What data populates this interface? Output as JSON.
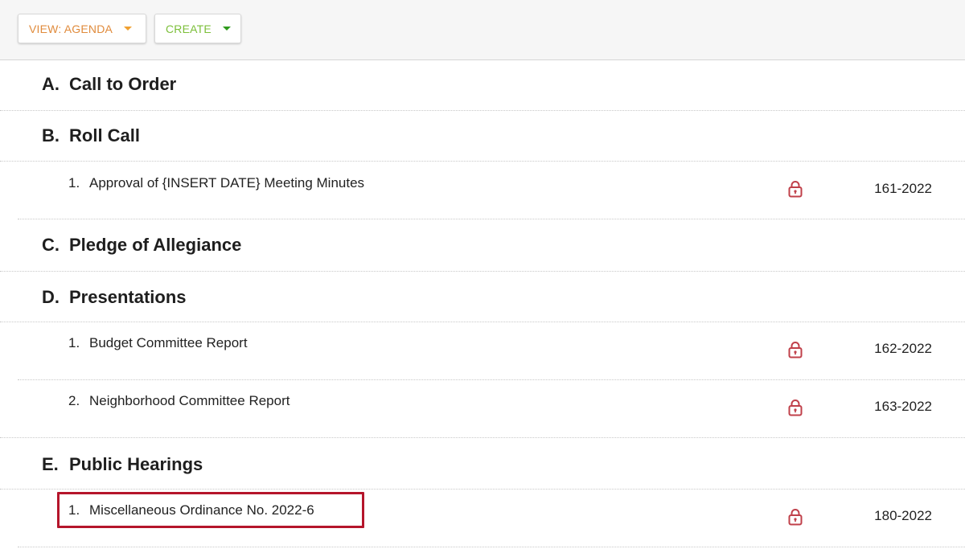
{
  "toolbar": {
    "view_label": "VIEW: AGENDA",
    "create_label": "CREATE"
  },
  "colors": {
    "view_accent": "#e08b3c",
    "create_accent": "#7cbf3a",
    "lock_icon": "#c0404a",
    "highlight_border": "#b5152b"
  },
  "sections": [
    {
      "letter": "A.",
      "title": "Call to Order",
      "items": []
    },
    {
      "letter": "B.",
      "title": "Roll Call",
      "items": [
        {
          "num": "1.",
          "title": "Approval of {INSERT DATE} Meeting Minutes",
          "icon": "lock-icon",
          "code": "161-2022"
        }
      ]
    },
    {
      "letter": "C.",
      "title": "Pledge of Allegiance",
      "items": []
    },
    {
      "letter": "D.",
      "title": "Presentations",
      "items": [
        {
          "num": "1.",
          "title": "Budget Committee Report",
          "icon": "lock-icon",
          "code": "162-2022"
        },
        {
          "num": "2.",
          "title": "Neighborhood Committee Report",
          "icon": "lock-icon",
          "code": "163-2022"
        }
      ]
    },
    {
      "letter": "E.",
      "title": "Public Hearings",
      "items": [
        {
          "num": "1.",
          "title": "Miscellaneous Ordinance No. 2022-6",
          "icon": "lock-icon",
          "code": "180-2022",
          "highlighted": true
        }
      ]
    }
  ]
}
